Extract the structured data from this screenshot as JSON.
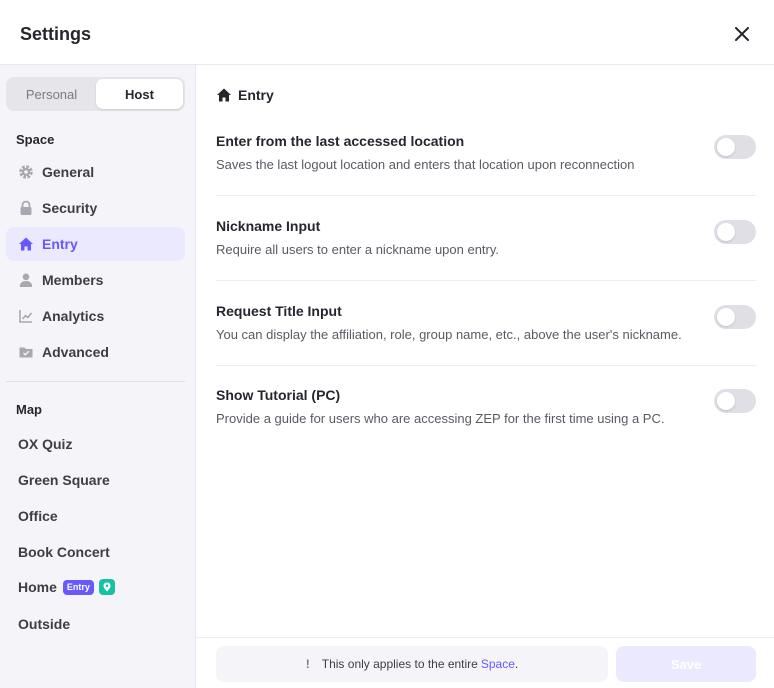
{
  "header": {
    "title": "Settings"
  },
  "tabs": {
    "personal": "Personal",
    "host": "Host"
  },
  "sidebar": {
    "space_label": "Space",
    "items": [
      {
        "label": "General",
        "icon": "gear-icon"
      },
      {
        "label": "Security",
        "icon": "lock-icon"
      },
      {
        "label": "Entry",
        "icon": "home-icon",
        "active": true
      },
      {
        "label": "Members",
        "icon": "person-icon"
      },
      {
        "label": "Analytics",
        "icon": "chart-icon"
      },
      {
        "label": "Advanced",
        "icon": "folder-icon"
      }
    ],
    "map_label": "Map",
    "maps": [
      {
        "label": "OX Quiz"
      },
      {
        "label": "Green Square"
      },
      {
        "label": "Office"
      },
      {
        "label": "Book Concert"
      },
      {
        "label": "Home",
        "badge": "Entry",
        "pin_icon": "location-pin-icon"
      },
      {
        "label": "Outside"
      }
    ]
  },
  "content": {
    "heading": "Entry",
    "settings": [
      {
        "title": "Enter from the last accessed location",
        "desc": "Saves the last logout location and enters that location upon reconnection",
        "enabled": false
      },
      {
        "title": "Nickname Input",
        "desc": "Require all users to enter a nickname upon entry.",
        "enabled": false
      },
      {
        "title": "Request Title Input",
        "desc": "You can display the affiliation, role, group name, etc., above the user's nickname.",
        "enabled": false
      },
      {
        "title": "Show Tutorial (PC)",
        "desc": "Provide a guide for users who are accessing ZEP for the first time using a PC.",
        "enabled": false
      }
    ]
  },
  "footer": {
    "notice_mark": "!",
    "notice_text": "This only applies to the entire",
    "notice_highlight": "Space",
    "notice_end": ".",
    "save_label": "Save"
  },
  "colors": {
    "accent": "#6758ff",
    "accent_light": "#ebe9fd",
    "toggle_off": "#e0dfe6",
    "pin_badge": "#17c2a4"
  }
}
